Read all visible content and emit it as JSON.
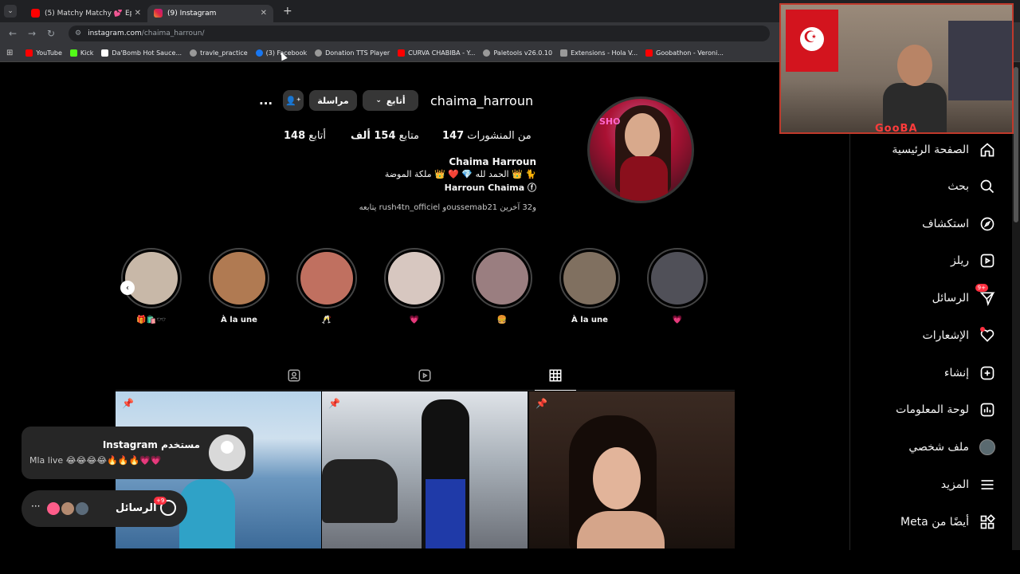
{
  "browser": {
    "tabs": [
      {
        "title": "(5) Matchy Matchy 💕 Ep 62: C",
        "favicon_color": "#ff0000"
      },
      {
        "title": "(9) Instagram",
        "favicon_color": "#e1306c"
      }
    ],
    "url_host": "instagram.com",
    "url_path": "/chaima_harroun/",
    "bookmarks": [
      {
        "label": "YouTube",
        "color": "#ff0000"
      },
      {
        "label": "Kick",
        "color": "#53fc18"
      },
      {
        "label": "Da'Bomb Hot Sauce...",
        "color": "#ffffff"
      },
      {
        "label": "travle_practice",
        "color": "#999999"
      },
      {
        "label": "(3) Facebook",
        "color": "#1877f2"
      },
      {
        "label": "Donation TTS Player",
        "color": "#999999"
      },
      {
        "label": "CURVA CHABIBA - Y...",
        "color": "#ff0000"
      },
      {
        "label": "Paletools v26.0.10",
        "color": "#999999"
      },
      {
        "label": "Extensions - Hola V...",
        "color": "#999999"
      },
      {
        "label": "Goobathon - Veroni...",
        "color": "#ff0000"
      }
    ]
  },
  "profile": {
    "username": "chaima_harroun",
    "follow_btn": "أتابع",
    "message_btn": "مراسلة",
    "more_icon": "...",
    "posts_count": "147",
    "posts_label": "من المنشورات",
    "followers_count": "154 ألف",
    "followers_label": "متابع",
    "following_count": "148",
    "following_label": "أتابع",
    "full_name": "Chaima Harroun",
    "bio_line": "الحمد لله 💎 ❤️ 👑 ملكة الموضة 👑 🐈",
    "fb_link": "Harroun Chaima",
    "followed_by": "يتابعه rush4tn_officiel وoussemab21 و32 آخرين"
  },
  "stories": [
    {
      "label": "🎁🛍️🕶️",
      "color": "#c8b8a8"
    },
    {
      "label": "À la une",
      "color": "#b07a52"
    },
    {
      "label": "🥂",
      "color": "#c07060"
    },
    {
      "label": "💗",
      "color": "#d7c7c0"
    },
    {
      "label": "🍔",
      "color": "#9a7e80"
    },
    {
      "label": "À la une",
      "color": "#807060"
    },
    {
      "label": "💗",
      "color": "#505058"
    }
  ],
  "sidebar": [
    {
      "label": "الصفحة الرئيسية",
      "icon": "home-icon"
    },
    {
      "label": "بحث",
      "icon": "search-icon"
    },
    {
      "label": "استكشاف",
      "icon": "compass-icon"
    },
    {
      "label": "ريلز",
      "icon": "reels-icon"
    },
    {
      "label": "الرسائل",
      "icon": "send-icon",
      "badge": "+9"
    },
    {
      "label": "الإشعارات",
      "icon": "heart-icon"
    },
    {
      "label": "إنشاء",
      "icon": "plus-icon"
    },
    {
      "label": "لوحة المعلومات",
      "icon": "dashboard-icon"
    },
    {
      "label": "ملف شخصي",
      "icon": "avatar-icon"
    },
    {
      "label": "المزيد",
      "icon": "menu-icon"
    },
    {
      "label": "أيضًا من Meta",
      "icon": "meta-icon"
    }
  ],
  "notification": {
    "title": "مستخدم Instagram",
    "message": "Mla live 😂😂😂😂🔥🔥🔥💗💗"
  },
  "messages_pill": {
    "label": "الرسائل",
    "badge": "+9"
  },
  "webcam": {
    "overlay_text": "GooBA"
  }
}
